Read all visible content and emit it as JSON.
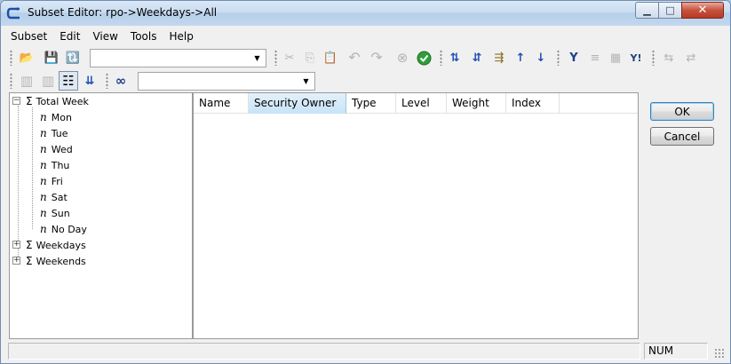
{
  "window": {
    "title": "Subset Editor: rpo->Weekdays->All",
    "minimize_glyph": "▁",
    "maximize_glyph": "□",
    "close_glyph": "✕"
  },
  "menu": [
    {
      "label": "Subset"
    },
    {
      "label": "Edit"
    },
    {
      "label": "View"
    },
    {
      "label": "Tools"
    },
    {
      "label": "Help"
    }
  ],
  "toolbar1": {
    "combo_value": "",
    "icons": {
      "open_subset": "📂",
      "save_subset": "💾",
      "refresh": "🔃",
      "cut": "✂",
      "copy": "⎘",
      "paste": "📋",
      "undo": "↶",
      "redo": "↷",
      "cancel": "⊗",
      "accept": "✔",
      "sort_asc": "⇅",
      "sort_desc": "⇵",
      "sort_hier": "⇶",
      "sort_index_asc": "↑",
      "sort_index_desc": "↓",
      "filter": "Y",
      "filter_level": "≡",
      "filter_attr": "▦",
      "filter_expr": "Y!",
      "expand": "⇆",
      "collapse": "⇄"
    }
  },
  "toolbar2": {
    "combo_value": "",
    "icons": {
      "insert_before": "▥",
      "insert_after": "▥",
      "tree_view": "☷",
      "expand_down": "⇊",
      "alias": "∞"
    }
  },
  "tree": [
    {
      "label": "Total Week",
      "symbol": "Σ",
      "expander": "⊟",
      "level": 0
    },
    {
      "label": "Mon",
      "symbol": "n",
      "level": 1
    },
    {
      "label": "Tue",
      "symbol": "n",
      "level": 1
    },
    {
      "label": "Wed",
      "symbol": "n",
      "level": 1
    },
    {
      "label": "Thu",
      "symbol": "n",
      "level": 1
    },
    {
      "label": "Fri",
      "symbol": "n",
      "level": 1
    },
    {
      "label": "Sat",
      "symbol": "n",
      "level": 1
    },
    {
      "label": "Sun",
      "symbol": "n",
      "level": 1
    },
    {
      "label": "No Day",
      "symbol": "n",
      "level": 1
    },
    {
      "label": "Weekdays",
      "symbol": "Σ",
      "expander": "⊞",
      "level": 0
    },
    {
      "label": "Weekends",
      "symbol": "Σ",
      "expander": "⊞",
      "level": 0
    }
  ],
  "list": {
    "columns": [
      {
        "label": "Name"
      },
      {
        "label": "Security Owner"
      },
      {
        "label": "Type"
      },
      {
        "label": "Level"
      },
      {
        "label": "Weight"
      },
      {
        "label": "Index"
      }
    ],
    "rows": []
  },
  "buttons": {
    "ok": "OK",
    "cancel": "Cancel"
  },
  "status": {
    "message": "",
    "num": "NUM"
  },
  "colors": {
    "title_bar": "#c9dcf1",
    "active_column": "#c8e3f6",
    "close_button": "#c7523c"
  }
}
